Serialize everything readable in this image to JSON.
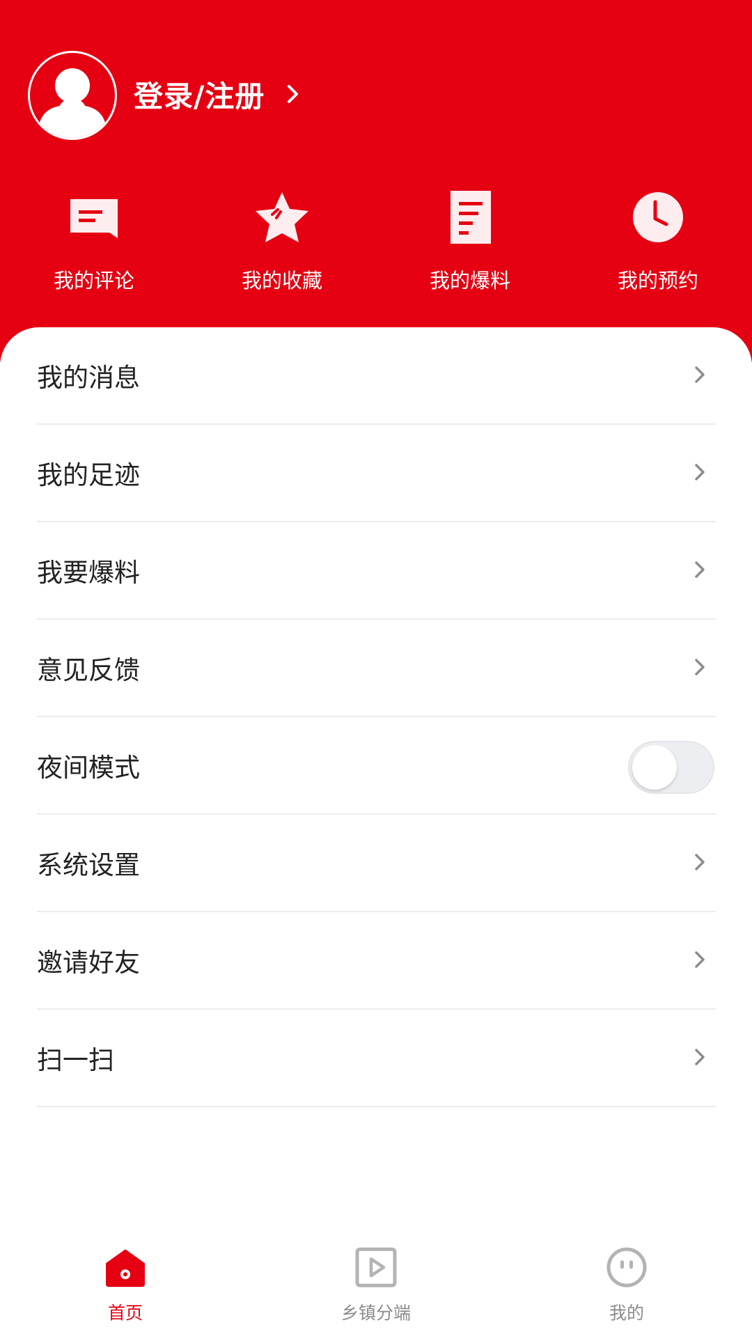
{
  "colors": {
    "brand": "#e50012",
    "text": "#222222",
    "muted": "#8c8c8c",
    "divider": "#ececec"
  },
  "profile": {
    "login_label": "登录/注册",
    "avatar_icon": "default-user-avatar-icon",
    "chevron_icon": "chevron-right-icon"
  },
  "quick_actions": [
    {
      "label": "我的评论",
      "icon": "comment-icon"
    },
    {
      "label": "我的收藏",
      "icon": "star-icon"
    },
    {
      "label": "我的爆料",
      "icon": "document-icon"
    },
    {
      "label": "我的预约",
      "icon": "clock-icon"
    }
  ],
  "menu": [
    {
      "label": "我的消息",
      "control": "chevron"
    },
    {
      "label": "我的足迹",
      "control": "chevron"
    },
    {
      "label": "我要爆料",
      "control": "chevron"
    },
    {
      "label": "意见反馈",
      "control": "chevron"
    },
    {
      "label": "夜间模式",
      "control": "toggle",
      "toggle_on": false
    },
    {
      "label": "系统设置",
      "control": "chevron"
    },
    {
      "label": "邀请好友",
      "control": "chevron"
    },
    {
      "label": "扫一扫",
      "control": "chevron"
    }
  ],
  "tabbar": [
    {
      "label": "首页",
      "icon": "home-icon",
      "active": true
    },
    {
      "label": "乡镇分端",
      "icon": "video-play-icon",
      "active": false
    },
    {
      "label": "我的",
      "icon": "face-icon",
      "active": false
    }
  ]
}
